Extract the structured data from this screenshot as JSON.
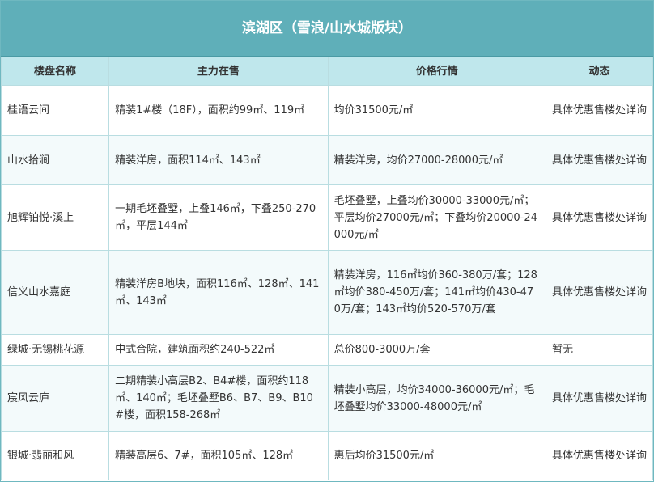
{
  "title": "滨湖区（雪浪/山水城版块）",
  "columns": [
    "楼盘名称",
    "主力在售",
    "价格行情",
    "动态"
  ],
  "rows": [
    {
      "name": "桂语云间",
      "product": "精装1#楼（18F），面积约99㎡、119㎡",
      "price": "均价31500元/㎡",
      "status": "具体优惠售楼处详询"
    },
    {
      "name": "山水拾涧",
      "product": "精装洋房，面积114㎡、143㎡",
      "price": "精装洋房，均价27000-28000元/㎡",
      "status": "具体优惠售楼处详询"
    },
    {
      "name": "旭辉铂悦·溪上",
      "product": "一期毛坯叠墅，上叠146㎡，下叠250-270㎡，平层144㎡",
      "price": "毛坯叠墅，上叠均价30000-33000元/㎡；平层均价27000元/㎡；下叠均价20000-24000元/㎡",
      "status": "具体优惠售楼处详询"
    },
    {
      "name": "信义山水嘉庭",
      "product": "精装洋房B地块，面积116㎡、128㎡、141㎡、143㎡",
      "price": "精装洋房，116㎡均价360-380万/套；128㎡均价380-450万/套；141㎡均价430-470万/套；143㎡均价520-570万/套",
      "status": "具体优惠售楼处详询"
    },
    {
      "name": "绿城·无锡桃花源",
      "product": "中式合院，建筑面积约240-522㎡",
      "price": "总价800-3000万/套",
      "status": "暂无"
    },
    {
      "name": "宸风云庐",
      "product": "二期精装小高层B2、B4#楼，面积约118㎡、140㎡；毛坯叠墅B6、B7、B9、B10#楼，面积158-268㎡",
      "price": "精装小高层，均价34000-36000元/㎡；毛坯叠墅均价33000-48000元/㎡",
      "status": "具体优惠售楼处详询"
    },
    {
      "name": "银城·翡丽和风",
      "product": "精装高层6、7#，面积105㎡、128㎡",
      "price": "惠后均价31500元/㎡",
      "status": "具体优惠售楼处详询"
    }
  ]
}
